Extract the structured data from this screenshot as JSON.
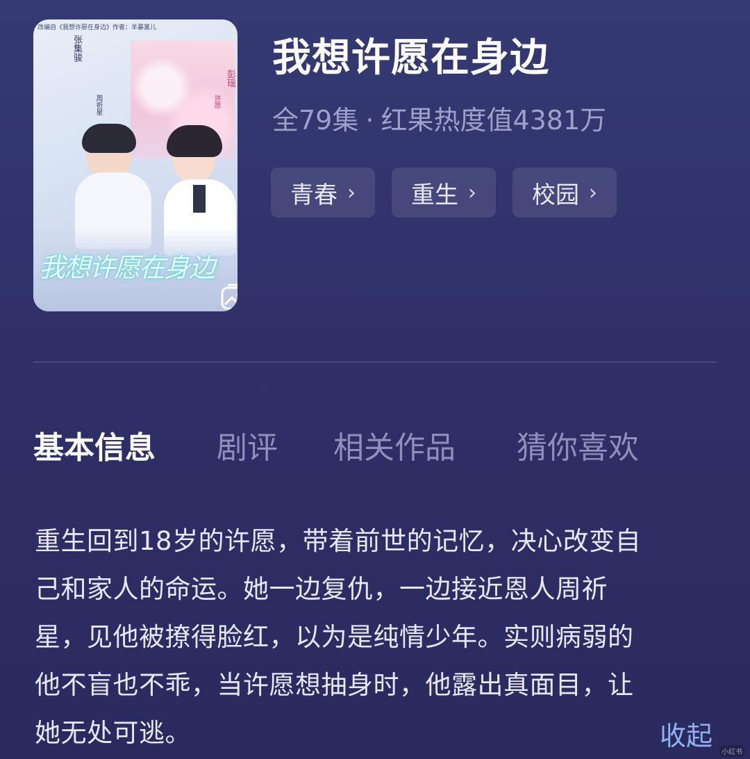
{
  "poster": {
    "caption": "改编自《我想许愿在身边》作者：羊暴富儿",
    "actor_left": "张集骏",
    "role_left": "周祈星",
    "actor_right": "彭瑶",
    "role_right": "许愿",
    "title_art": "我想许愿在身边",
    "gallery_icon": "gallery-icon"
  },
  "drama": {
    "title": "我想许愿在身边",
    "episodes": "全79集",
    "separator": "·",
    "heat": "红果热度值4381万"
  },
  "tags": [
    {
      "label": "青春",
      "chevron": "›"
    },
    {
      "label": "重生",
      "chevron": "›"
    },
    {
      "label": "校园",
      "chevron": "›"
    }
  ],
  "tabs": [
    {
      "label": "基本信息",
      "active": true
    },
    {
      "label": "剧评",
      "active": false
    },
    {
      "label": "相关作品",
      "active": false
    },
    {
      "label": "猜你喜欢",
      "active": false
    }
  ],
  "description": {
    "lines": [
      "重生回到18岁的许愿，带着前世的记忆，决心改变自",
      "己和家人的命运。她一边复仇，一边接近恩人周祈",
      "星，见他被撩得脸红，以为是纯情少年。实则病弱的",
      "他不盲也不乖，当许愿想抽身时，他露出真面目，让",
      "她无处可逃。"
    ],
    "collapse_label": "收起"
  },
  "watermark": "小红书",
  "colors": {
    "background": "#2f3068",
    "accent_link": "#8fb3ee",
    "muted_text": "#9ea1c9",
    "tag_bg": "rgba(255,255,255,0.10)"
  }
}
